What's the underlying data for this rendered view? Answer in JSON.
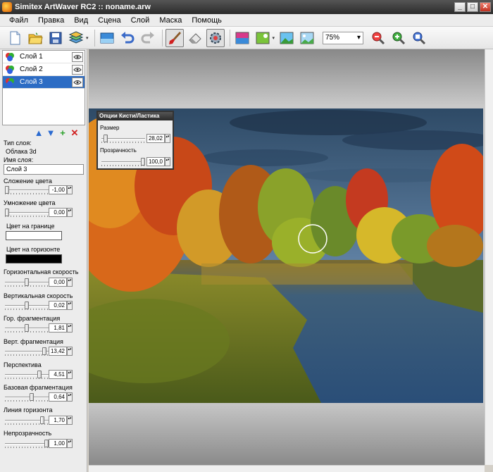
{
  "window": {
    "title": "Simitex ArtWaver RC2 :: noname.arw",
    "minimize": "_",
    "maximize": "□",
    "close": "✕"
  },
  "menu": [
    "Файл",
    "Правка",
    "Вид",
    "Сцена",
    "Слой",
    "Маска",
    "Помощь"
  ],
  "toolbar": {
    "zoom_value": "75%",
    "zoom_arrow": "▾",
    "tools": [
      "new-icon",
      "open-icon",
      "save-icon",
      "layers-icon",
      "image-icon",
      "undo-icon",
      "redo-icon",
      "brush-icon",
      "eraser-icon",
      "settings-icon",
      "fill-icon",
      "gradient-icon",
      "picture-a-icon",
      "picture-b-icon",
      "zoom-out-icon",
      "zoom-in-icon",
      "zoom-fit-icon"
    ]
  },
  "layers": [
    {
      "name": "Слой 1",
      "selected": false
    },
    {
      "name": "Слой 2",
      "selected": false
    },
    {
      "name": "Слой 3",
      "selected": true
    }
  ],
  "layer_actions": {
    "up": "▲",
    "down": "▼",
    "add": "+",
    "delete": "✕"
  },
  "properties": {
    "type_label": "Тип слоя:",
    "type_value": "Облака 3d",
    "name_label": "Имя слоя:",
    "name_value": "Слой 3",
    "color_add": {
      "label": "Сложение цвета",
      "value": "-1,00",
      "level": 0.0
    },
    "color_mult": {
      "label": "Умножение цвета",
      "value": "0,00",
      "level": 0.0
    },
    "edge_color": {
      "label": "Цвет на границе",
      "color": "#ffffff"
    },
    "horizon_color": {
      "label": "Цвет на горизонте",
      "color": "#000000"
    },
    "h_speed": {
      "label": "Горизонтальная скорость",
      "value": "0,00",
      "level": 0.5
    },
    "v_speed": {
      "label": "Вертикальная скорость",
      "value": "0,02",
      "level": 0.5
    },
    "h_frag": {
      "label": "Гор. фрагментация",
      "value": "1,81",
      "level": 0.5
    },
    "v_frag": {
      "label": "Верт. фрагментация",
      "value": "13,42",
      "level": 0.95
    },
    "perspective": {
      "label": "Перспектива",
      "value": "4,51",
      "level": 0.82
    },
    "base_frag": {
      "label": "Базовая фрагментация",
      "value": "0,64",
      "level": 0.62
    },
    "horizon_line": {
      "label": "Линия горизонта",
      "value": "1,70",
      "level": 0.9
    },
    "opacity": {
      "label": "Непрозрачность",
      "value": "1,00",
      "level": 1.0
    },
    "spin_glyph": "▴▾"
  },
  "brush_panel": {
    "title": "Опции Кисти/Ластика",
    "size_label": "Размер",
    "size_value": "28,02",
    "size_level": 0.05,
    "opacity_label": "Прозрачность",
    "opacity_value": "100,0",
    "opacity_level": 1.0,
    "spin_glyph": "▴▾"
  },
  "colors": {
    "accent": "#2c6cc4",
    "titlebar": "#2b2b2b"
  }
}
